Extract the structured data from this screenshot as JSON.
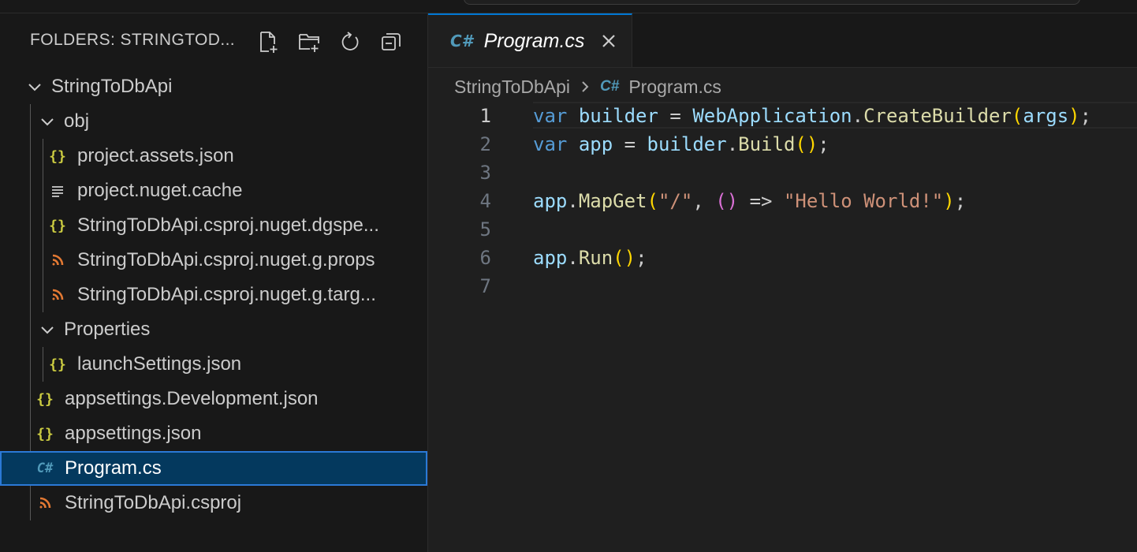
{
  "explorer": {
    "title": "FOLDERS: STRINGTOD...",
    "actions": [
      "new-file-icon",
      "new-folder-icon",
      "refresh-icon",
      "collapse-all-icon"
    ]
  },
  "tree": {
    "root": "StringToDbApi",
    "obj": "obj",
    "obj_files": [
      "project.assets.json",
      "project.nuget.cache",
      "StringToDbApi.csproj.nuget.dgspe...",
      "StringToDbApi.csproj.nuget.g.props",
      "StringToDbApi.csproj.nuget.g.targ..."
    ],
    "properties": "Properties",
    "properties_files": [
      "launchSettings.json"
    ],
    "root_files": [
      "appsettings.Development.json",
      "appsettings.json",
      "Program.cs",
      "StringToDbApi.csproj"
    ],
    "selected": "Program.cs"
  },
  "tab": {
    "icon": "C#",
    "label": "Program.cs",
    "close": "×"
  },
  "breadcrumb": {
    "folder": "StringToDbApi",
    "icon": "C#",
    "file": "Program.cs"
  },
  "code": {
    "active_line": 1,
    "line_numbers": [
      "1",
      "2",
      "3",
      "4",
      "5",
      "6",
      "7"
    ],
    "l1": {
      "t0": "var",
      "t1": "builder",
      "t2": "=",
      "t3": "WebApplication",
      "t4": ".",
      "t5": "CreateBuilder",
      "t6": "(",
      "t7": "args",
      "t8": ")",
      "t9": ";"
    },
    "l2": {
      "t0": "var",
      "t1": "app",
      "t2": "=",
      "t3": "builder",
      "t4": ".",
      "t5": "Build",
      "t6": "()",
      "t7": ";"
    },
    "l4": {
      "t0": "app",
      "t1": ".",
      "t2": "MapGet",
      "t3": "(",
      "t4": "\"/\"",
      "t5": ",",
      "t6": "()",
      "t7": "=>",
      "t8": "\"Hello World!\"",
      "t9": ")",
      "t10": ";"
    },
    "l6": {
      "t0": "app",
      "t1": ".",
      "t2": "Run",
      "t3": "()",
      "t4": ";"
    }
  },
  "colors": {
    "accent": "#0078d4",
    "selection": "#04395e",
    "json_icon": "#cbcb41",
    "csharp_icon": "#519aba",
    "msbuild_icon": "#e37933"
  }
}
